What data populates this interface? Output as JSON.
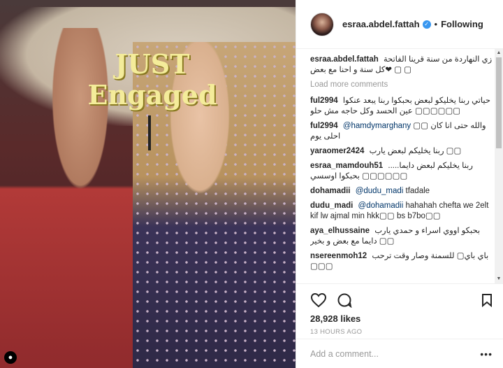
{
  "photo": {
    "prop_line1": "JUST",
    "prop_line2": "Engaged"
  },
  "header": {
    "username": "esraa.abdel.fattah",
    "verified_icon": "verified-badge-icon",
    "separator": "•",
    "follow_label": "Following"
  },
  "caption": {
    "user": "esraa.abdel.fattah",
    "text": "زي النهاردة من سنة قرينا الفاتحة ▢ ▢ ❤كل سنة و احنا مع بعض"
  },
  "load_more": "Load more comments",
  "comments": [
    {
      "user": "ful2994",
      "text": "حياتي ربنا يخليكو لبعض بحبكوا ربنا يبعد عنكوا ▢▢▢▢▢▢ عين الحسد وكل حاجه مش حلو",
      "rtl": true
    },
    {
      "user": "ful2994",
      "mention": "@hamdymarghany",
      "text": "والله حتى انا كان ▢▢ احلى يوم",
      "rtl": false
    },
    {
      "user": "yaraomer2424",
      "text": "▢▢ ربنا يخليكم لبعض يارب",
      "rtl": false
    },
    {
      "user": "esraa_mamdouh51",
      "text": "ربنا يخليكم لبعض دايما..... ▢▢▢▢▢▢ بحبكوا اوسسي",
      "rtl": false
    },
    {
      "user": "dohamadii",
      "mention": "@dudu_madi",
      "text": "tfadale",
      "rtl": false
    },
    {
      "user": "dudu_madi",
      "mention": "@dohamadii",
      "text": "hahahah chefta we 2elt kif lw ajmal min hkk▢▢ bs b7bo▢▢",
      "rtl": false
    },
    {
      "user": "aya_elhussaine",
      "text": "بحبكو اووي اسراء و حمدي يارب ▢▢ دايما مع بعض و بخير",
      "rtl": false
    },
    {
      "user": "nsereenmoh12",
      "text": "باي باي▢ للسمنة وصار وقت ترحب ▢▢▢",
      "rtl": false
    }
  ],
  "actions": {
    "like_icon": "heart-icon",
    "comment_icon": "comment-icon",
    "save_icon": "bookmark-icon",
    "likes": "28,928 likes",
    "time": "13 HOURS AGO"
  },
  "add_comment": {
    "placeholder": "Add a comment...",
    "value": "",
    "more_label": "•••"
  }
}
